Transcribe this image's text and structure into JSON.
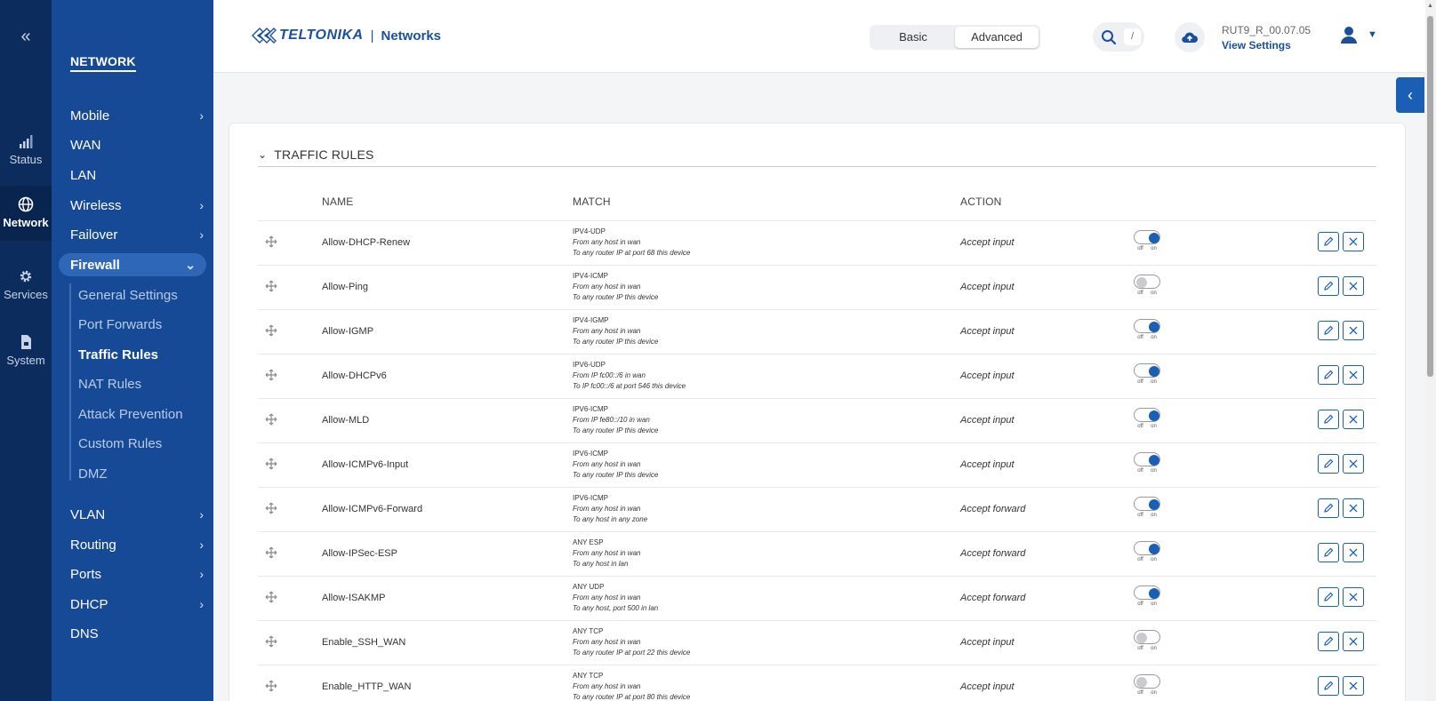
{
  "rail": {
    "collapse": "«",
    "items": [
      {
        "label": "Status"
      },
      {
        "label": "Network"
      },
      {
        "label": "Services"
      },
      {
        "label": "System"
      }
    ]
  },
  "nav": {
    "title": "NETWORK",
    "items": [
      "Mobile",
      "WAN",
      "LAN",
      "Wireless",
      "Failover",
      "Firewall",
      "VLAN",
      "Routing",
      "Ports",
      "DHCP",
      "DNS"
    ],
    "firewall_sub": [
      "General Settings",
      "Port Forwards",
      "Traffic Rules",
      "NAT Rules",
      "Attack Prevention",
      "Custom Rules",
      "DMZ"
    ]
  },
  "header": {
    "brand": "TELTONIKA",
    "sep": "|",
    "networks": "Networks",
    "mode_basic": "Basic",
    "mode_advanced": "Advanced",
    "search_key": "/",
    "firmware": "RUT9_R_00.07.05",
    "view_settings": "View Settings"
  },
  "section": {
    "title": "TRAFFIC RULES",
    "col_name": "NAME",
    "col_match": "MATCH",
    "col_action": "ACTION"
  },
  "toggle_labels": {
    "off": "off",
    "on": "on"
  },
  "rules": [
    {
      "name": "Allow-DHCP-Renew",
      "m1": "IPV4-UDP",
      "m2": "From any host in wan",
      "m3": "To any router IP at port 68 this device",
      "action": "Accept input",
      "enabled": true
    },
    {
      "name": "Allow-Ping",
      "m1": "IPV4-ICMP",
      "m2": "From any host in wan",
      "m3": "To any router IP this device",
      "action": "Accept input",
      "enabled": false
    },
    {
      "name": "Allow-IGMP",
      "m1": "IPV4-IGMP",
      "m2": "From any host in wan",
      "m3": "To any router IP this device",
      "action": "Accept input",
      "enabled": true
    },
    {
      "name": "Allow-DHCPv6",
      "m1": "IPV6-UDP",
      "m2": "From IP fc00::/6 in wan",
      "m3": "To IP fc00::/6 at port 546 this device",
      "action": "Accept input",
      "enabled": true
    },
    {
      "name": "Allow-MLD",
      "m1": "IPV6-ICMP",
      "m2": "From IP fe80::/10 in wan",
      "m3": "To any router IP this device",
      "action": "Accept input",
      "enabled": true
    },
    {
      "name": "Allow-ICMPv6-Input",
      "m1": "IPV6-ICMP",
      "m2": "From any host in wan",
      "m3": "To any router IP this device",
      "action": "Accept input",
      "enabled": true
    },
    {
      "name": "Allow-ICMPv6-Forward",
      "m1": "IPV6-ICMP",
      "m2": "From any host in wan",
      "m3": "To any host in any zone",
      "action": "Accept forward",
      "enabled": true
    },
    {
      "name": "Allow-IPSec-ESP",
      "m1": "ANY ESP",
      "m2": "From any host in wan",
      "m3": "To any host in lan",
      "action": "Accept forward",
      "enabled": true
    },
    {
      "name": "Allow-ISAKMP",
      "m1": "ANY UDP",
      "m2": "From any host in wan",
      "m3": "To any host, port 500 in lan",
      "action": "Accept forward",
      "enabled": true
    },
    {
      "name": "Enable_SSH_WAN",
      "m1": "ANY TCP",
      "m2": "From any host in wan",
      "m3": "To any router IP at port 22 this device",
      "action": "Accept input",
      "enabled": false
    },
    {
      "name": "Enable_HTTP_WAN",
      "m1": "ANY TCP",
      "m2": "From any host in wan",
      "m3": "To any router IP at port 80 this device",
      "action": "Accept input",
      "enabled": false
    }
  ]
}
